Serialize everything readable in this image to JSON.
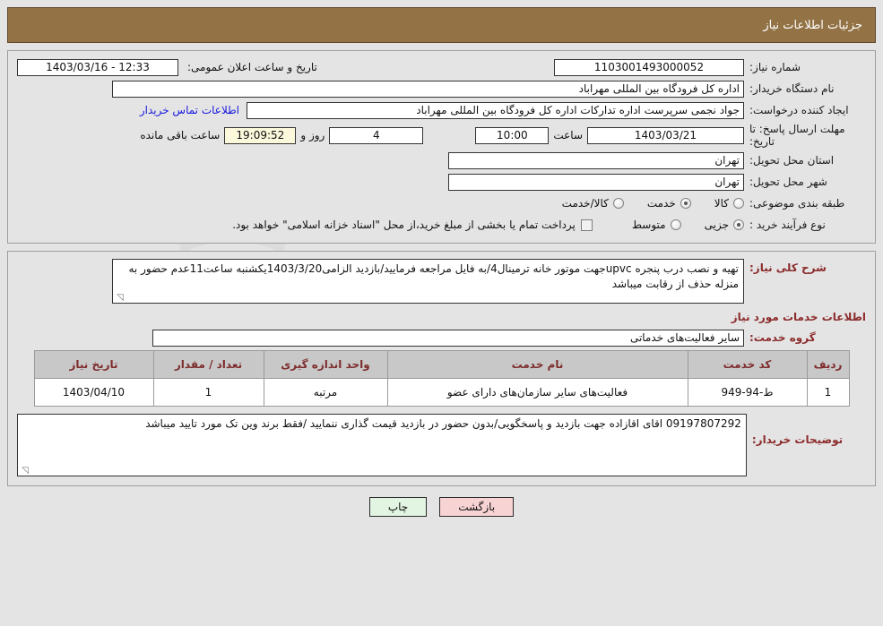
{
  "header": {
    "title": "جزئیات اطلاعات نیاز",
    "bar_color": "#937246"
  },
  "form": {
    "need_number_label": "شماره نیاز:",
    "need_number_value": "1103001493000052",
    "public_announce_label": "تاریخ و ساعت اعلان عمومی:",
    "public_announce_value": "12:33 - 1403/03/16",
    "buyer_org_label": "نام دستگاه خریدار:",
    "buyer_org_value": "اداره کل فرودگاه بین المللی مهراباد",
    "requester_label": "ایجاد کننده درخواست:",
    "requester_value": "جواد نجمی سرپرست اداره تدارکات  اداره کل فرودگاه بین المللی مهراباد",
    "contact_link": "اطلاعات تماس خریدار",
    "deadline_label": "مهلت ارسال پاسخ: تا تاریخ:",
    "deadline_date": "1403/03/21",
    "hour_label": "ساعت",
    "deadline_time": "10:00",
    "days_remaining": "4",
    "days_label": "روز و",
    "time_remaining": "19:09:52",
    "remaining_suffix": "ساعت باقی مانده",
    "province_label": "استان محل تحویل:",
    "province_value": "تهران",
    "city_label": "شهر محل تحویل:",
    "city_value": "تهران",
    "category_label": "طبقه بندی موضوعی:",
    "category_options": [
      {
        "label": "کالا",
        "selected": false
      },
      {
        "label": "خدمت",
        "selected": true
      },
      {
        "label": "کالا/خدمت",
        "selected": false
      }
    ],
    "process_label": "نوع فرآیند خرید :",
    "process_options": [
      {
        "label": "جزیی",
        "selected": true
      },
      {
        "label": "متوسط",
        "selected": false
      }
    ],
    "treasury_checkbox_text": "پرداخت تمام یا بخشی از مبلغ خرید،از محل \"اسناد خزانه اسلامی\" خواهد بود.",
    "treasury_checked": false
  },
  "description": {
    "label": "شرح کلی نیاز:",
    "value": "تهیه و نصب  درب پنجره upvcجهت موتور خانه ترمینال4/به فایل مراجعه فرمایید/بازدید الزامی1403/3/20یکشنبه ساعت11عدم حضور به منزله حذف از رقابت میباشد"
  },
  "services": {
    "section_title": "اطلاعات خدمات مورد نیاز",
    "group_label": "گروه خدمت:",
    "group_value": "سایر فعالیت‌های خدماتی",
    "table": {
      "columns": [
        "ردیف",
        "کد خدمت",
        "نام خدمت",
        "واحد اندازه گیری",
        "تعداد / مقدار",
        "تاریخ نیاز"
      ],
      "rows": [
        {
          "index": "1",
          "code": "ط-94-949",
          "name": "فعالیت‌های سایر سازمان‌های دارای عضو",
          "unit": "مرتبه",
          "quantity": "1",
          "need_date": "1403/04/10"
        }
      ]
    }
  },
  "buyer_notes": {
    "label": "توضیحات خریدار:",
    "value": "09197807292 اقای اقازاده جهت بازدید و پاسخگویی/بدون حضور در بازدید قیمت گذاری ننمایید /فقط برند وین تک مورد تایید میباشد"
  },
  "footer": {
    "print_label": "چاپ",
    "back_label": "بازگشت"
  },
  "watermark": {
    "text": "AriaTender.net"
  }
}
